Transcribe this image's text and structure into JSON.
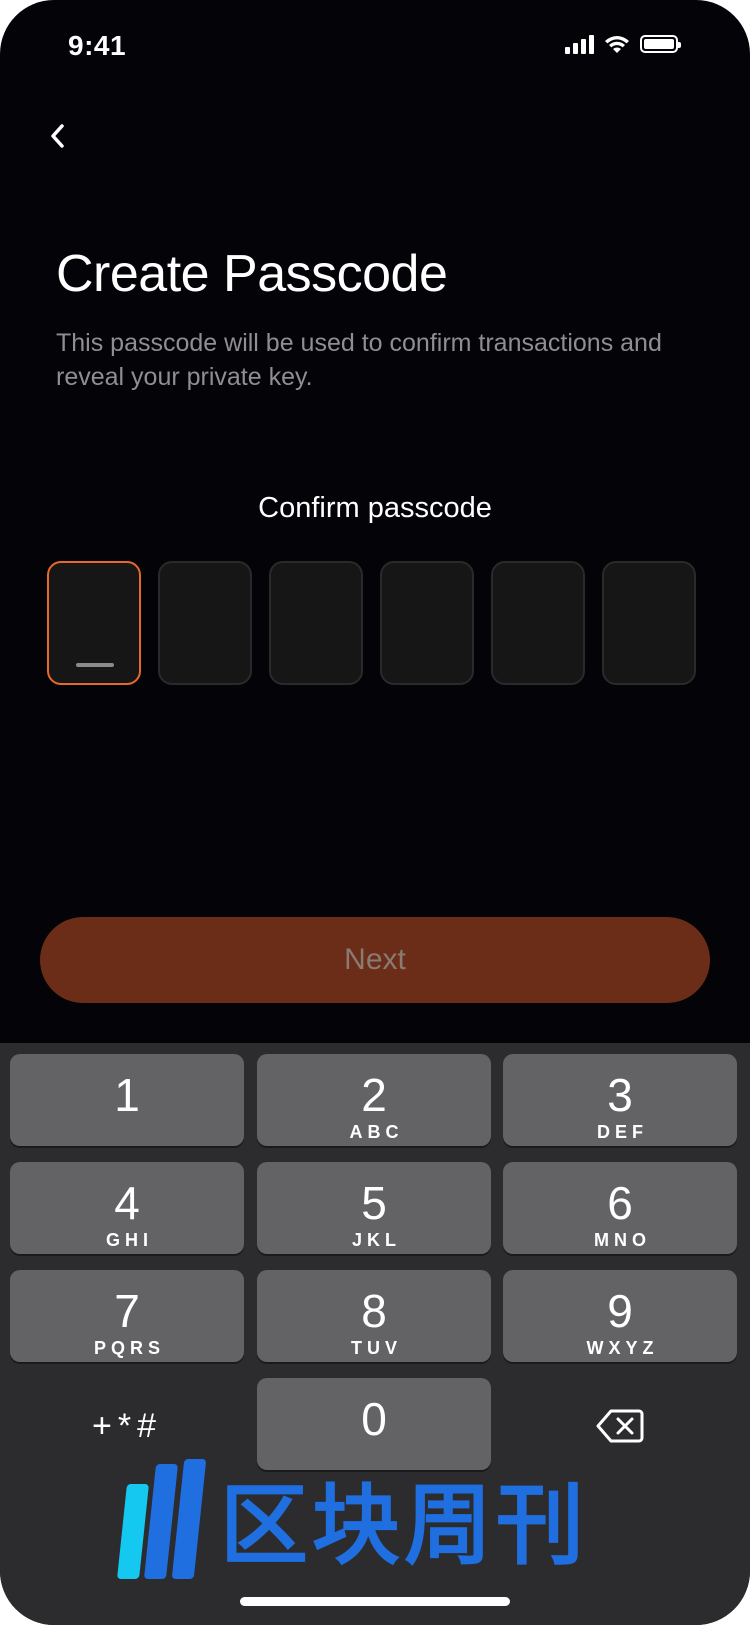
{
  "status_bar": {
    "time": "9:41"
  },
  "header": {
    "back_icon": "chevron-left-icon"
  },
  "title": "Create Passcode",
  "subtitle": "This passcode will be used to confirm transactions and reveal your private key.",
  "passcode": {
    "label": "Confirm passcode",
    "length": 6,
    "filled": 0
  },
  "next_button": {
    "label": "Next"
  },
  "keypad": {
    "keys": [
      {
        "num": "1",
        "letters": ""
      },
      {
        "num": "2",
        "letters": "ABC"
      },
      {
        "num": "3",
        "letters": "DEF"
      },
      {
        "num": "4",
        "letters": "GHI"
      },
      {
        "num": "5",
        "letters": "JKL"
      },
      {
        "num": "6",
        "letters": "MNO"
      },
      {
        "num": "7",
        "letters": "PQRS"
      },
      {
        "num": "8",
        "letters": "TUV"
      },
      {
        "num": "9",
        "letters": "WXYZ"
      },
      {
        "num": "0",
        "letters": ""
      }
    ],
    "symbols_label": "+*#",
    "delete_icon": "backspace-icon"
  },
  "watermark": {
    "text": "区块周刊"
  },
  "colors": {
    "accent": "#e8682a",
    "next_bg": "#6b2d17",
    "background": "#030308",
    "keyboard_bg": "#2c2c2e",
    "key_bg": "#636366"
  }
}
